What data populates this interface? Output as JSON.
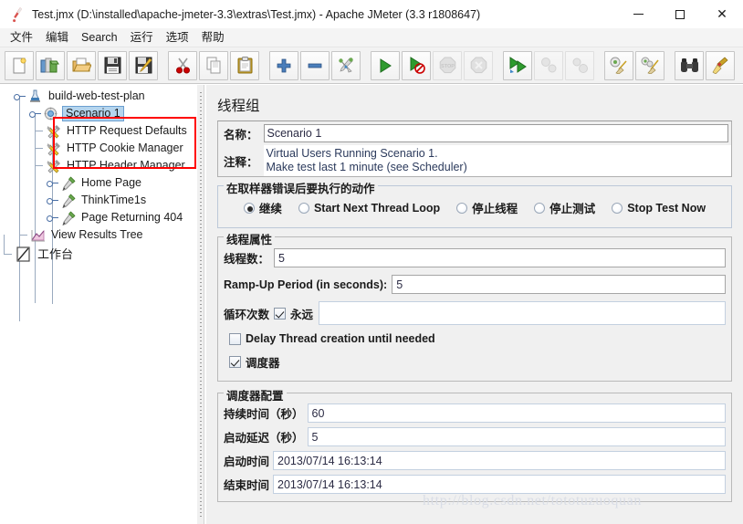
{
  "window": {
    "title": "Test.jmx (D:\\installed\\apache-jmeter-3.3\\extras\\Test.jmx) - Apache JMeter (3.3 r1808647)",
    "app_icon": "jmeter-feather-icon",
    "controls": {
      "minimize": "minimize-icon",
      "maximize": "maximize-icon",
      "close": "close-icon"
    }
  },
  "menubar": {
    "items": [
      {
        "label": "文件"
      },
      {
        "label": "编辑"
      },
      {
        "label": "Search"
      },
      {
        "label": "运行"
      },
      {
        "label": "选项"
      },
      {
        "label": "帮助"
      }
    ]
  },
  "toolbar": {
    "groups": [
      {
        "buttons": [
          {
            "name": "new-test-plan-button",
            "icon": "new-document-icon",
            "disabled": false
          },
          {
            "name": "templates-button",
            "icon": "templates-books-icon",
            "disabled": false
          },
          {
            "name": "open-button",
            "icon": "open-folder-icon",
            "disabled": false
          },
          {
            "name": "save-button",
            "icon": "floppy-disk-icon",
            "disabled": false
          },
          {
            "name": "save-as-button",
            "icon": "floppy-pencil-icon",
            "disabled": false
          }
        ]
      },
      {
        "buttons": [
          {
            "name": "cut-button",
            "icon": "scissors-icon",
            "disabled": false
          },
          {
            "name": "copy-button",
            "icon": "copy-pages-icon",
            "disabled": false
          },
          {
            "name": "paste-button",
            "icon": "clipboard-icon",
            "disabled": false
          }
        ]
      },
      {
        "buttons": [
          {
            "name": "expand-all-button",
            "icon": "plus-icon",
            "disabled": false
          },
          {
            "name": "collapse-all-button",
            "icon": "minus-icon",
            "disabled": false
          },
          {
            "name": "toggle-button",
            "icon": "toggle-pins-icon",
            "disabled": false
          }
        ]
      },
      {
        "buttons": [
          {
            "name": "start-button",
            "icon": "play-green-icon",
            "disabled": false
          },
          {
            "name": "start-no-pauses-button",
            "icon": "play-no-pause-icon",
            "disabled": false
          },
          {
            "name": "stop-button",
            "icon": "stop-sign-icon",
            "disabled": true
          },
          {
            "name": "shutdown-button",
            "icon": "shutdown-octagon-icon",
            "disabled": true
          }
        ]
      },
      {
        "buttons": [
          {
            "name": "remote-start-all-button",
            "icon": "remote-start-icon",
            "disabled": false
          },
          {
            "name": "remote-stop-all-button",
            "icon": "remote-stop-icon",
            "disabled": true
          },
          {
            "name": "remote-shutdown-all-button",
            "icon": "remote-shutdown-icon",
            "disabled": true
          }
        ]
      },
      {
        "buttons": [
          {
            "name": "clear-button",
            "icon": "gear-broom-icon",
            "disabled": false
          },
          {
            "name": "clear-all-button",
            "icon": "gears-broom-icon",
            "disabled": false
          }
        ]
      },
      {
        "buttons": [
          {
            "name": "search-button",
            "icon": "binoculars-icon",
            "disabled": false
          },
          {
            "name": "reset-search-button",
            "icon": "broom-icon",
            "disabled": false
          }
        ]
      }
    ]
  },
  "tree": {
    "nodes": [
      {
        "label": "build-web-test-plan",
        "icon": "test-plan-icon",
        "depth": 0,
        "selected": false,
        "expandable": true
      },
      {
        "label": "Scenario 1",
        "icon": "thread-group-icon",
        "depth": 1,
        "selected": true,
        "expandable": true
      },
      {
        "label": "HTTP Request Defaults",
        "icon": "config-tools-icon",
        "depth": 2,
        "selected": false,
        "expandable": false
      },
      {
        "label": "HTTP Cookie Manager",
        "icon": "config-tools-icon",
        "depth": 2,
        "selected": false,
        "expandable": false
      },
      {
        "label": "HTTP Header Manager",
        "icon": "config-tools-icon",
        "depth": 2,
        "selected": false,
        "expandable": false
      },
      {
        "label": "Home Page",
        "icon": "sampler-pen-icon",
        "depth": 2,
        "selected": false,
        "expandable": true
      },
      {
        "label": "ThinkTime1s",
        "icon": "sampler-pen-icon",
        "depth": 2,
        "selected": false,
        "expandable": true
      },
      {
        "label": "Page Returning 404",
        "icon": "sampler-pen-icon",
        "depth": 2,
        "selected": false,
        "expandable": true
      },
      {
        "label": "View Results Tree",
        "icon": "results-chart-icon",
        "depth": 1,
        "selected": false,
        "expandable": false
      },
      {
        "label": "工作台",
        "icon": "workbench-icon",
        "depth": 0,
        "selected": false,
        "expandable": false
      }
    ],
    "highlight_color": "#ff0000"
  },
  "main": {
    "title": "线程组",
    "name_label": "名称：",
    "name_value": "Scenario 1",
    "comments_label": "注释：",
    "comments_lines": [
      "Virtual Users Running Scenario 1.",
      "Make test last 1 minute (see Scheduler)"
    ],
    "on_error": {
      "legend": "在取样器错误后要执行的动作",
      "options": [
        {
          "label": "继续",
          "checked": true
        },
        {
          "label": "Start Next Thread Loop",
          "checked": false
        },
        {
          "label": "停止线程",
          "checked": false
        },
        {
          "label": "停止测试",
          "checked": false
        },
        {
          "label": "Stop Test Now",
          "checked": false
        }
      ]
    },
    "thread_props": {
      "legend": "线程属性",
      "threads_label": "线程数：",
      "threads_value": "5",
      "rampup_label": "Ramp-Up Period (in seconds):",
      "rampup_value": "5",
      "loop_label": "循环次数",
      "loop_forever_label": "永远",
      "loop_forever_checked": true,
      "loop_count_value": "",
      "delay_label": "Delay Thread creation until needed",
      "delay_checked": false,
      "scheduler_label": "调度器",
      "scheduler_checked": true
    },
    "scheduler": {
      "legend": "调度器配置",
      "duration_label": "持续时间（秒）",
      "duration_value": "60",
      "startup_delay_label": "启动延迟（秒）",
      "startup_delay_value": "5",
      "start_time_label": "启动时间",
      "start_time_value": "2013/07/14 16:13:14",
      "end_time_label": "结束时间",
      "end_time_value": "2013/07/14 16:13:14"
    }
  },
  "watermark": {
    "text": "http://blog.csdn.net/tototuzuoquan"
  },
  "colors": {
    "selection": "#b5d5ee",
    "highlight": "#ff0000",
    "panel_bg": "#f0f0f0",
    "field_bg": "#ffffff",
    "text": "#1b1b1b"
  }
}
